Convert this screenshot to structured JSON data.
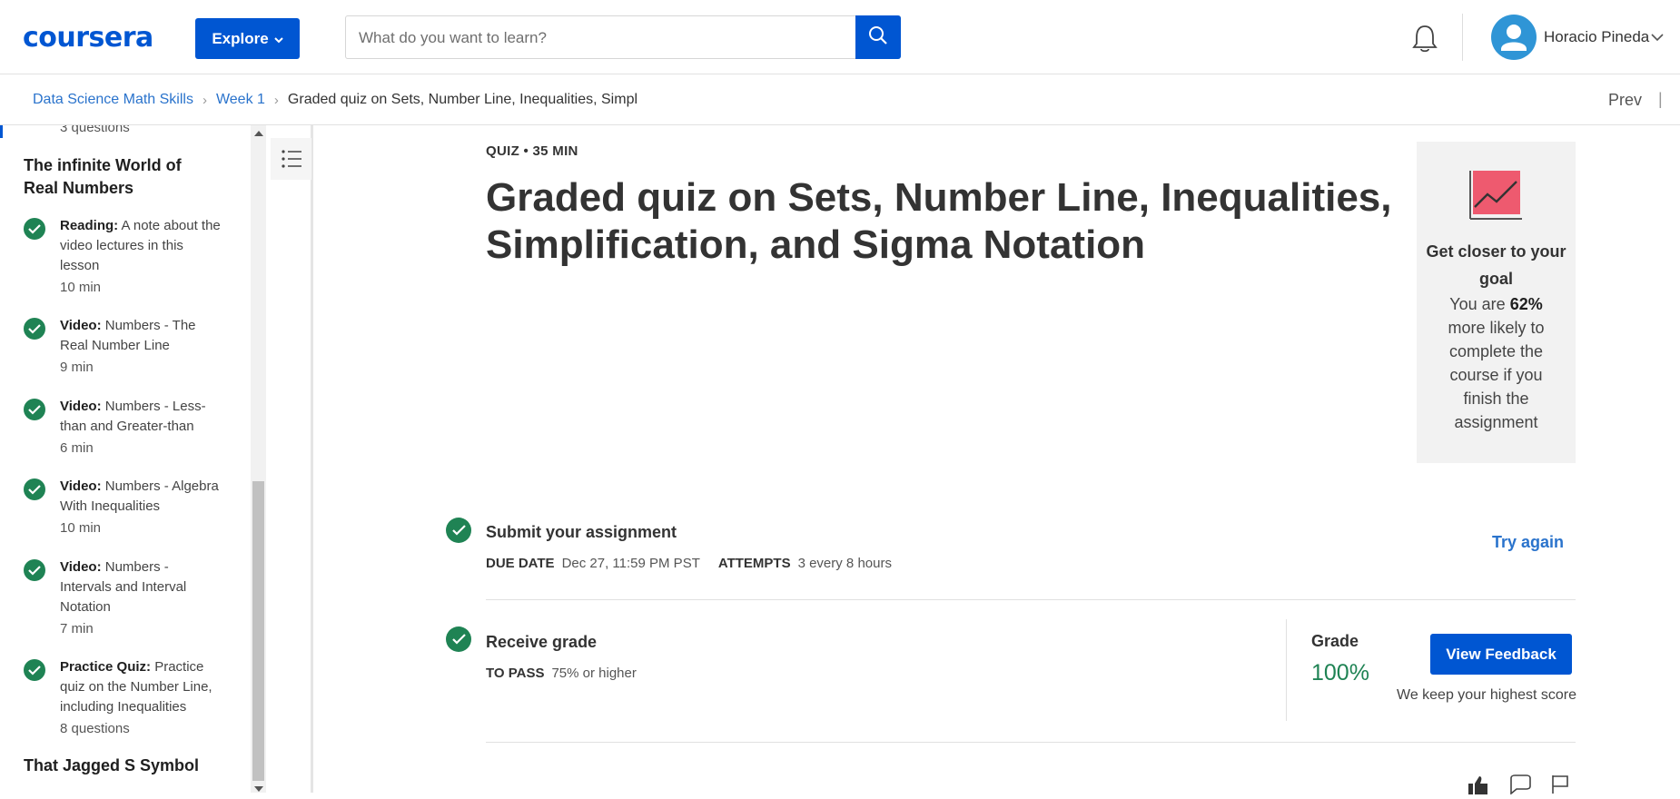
{
  "header": {
    "logo": "coursera",
    "explore_label": "Explore",
    "search_placeholder": "What do you want to learn?",
    "user_name": "Horacio Pineda"
  },
  "breadcrumb": {
    "items": [
      "Data Science Math Skills",
      "Week 1",
      "Graded quiz on Sets, Number Line, Inequalities, Simpl"
    ],
    "prev_label": "Prev",
    "separator": "|"
  },
  "sidebar": {
    "top_meta": "3 questions",
    "section_1": "The infinite World of Real Numbers",
    "items": [
      {
        "type": "Reading:",
        "title": "A note about the video lectures in this lesson",
        "duration": "10 min"
      },
      {
        "type": "Video:",
        "title": "Numbers - The Real Number Line",
        "duration": "9 min"
      },
      {
        "type": "Video:",
        "title": "Numbers - Less-than and Greater-than",
        "duration": "6 min"
      },
      {
        "type": "Video:",
        "title": "Numbers - Algebra With Inequalities",
        "duration": "10 min"
      },
      {
        "type": "Video:",
        "title": "Numbers - Intervals and Interval Notation",
        "duration": "7 min"
      },
      {
        "type": "Practice Quiz:",
        "title": "Practice quiz on the Number Line, including Inequalities",
        "duration": "8 questions"
      }
    ],
    "section_2": "That Jagged S Symbol"
  },
  "main": {
    "quiz_meta": "QUIZ • 35 MIN",
    "title": "Graded quiz on Sets, Number Line, Inequalities, Simplification, and Sigma Notation",
    "submit": {
      "title": "Submit your assignment",
      "due_label": "DUE DATE",
      "due_value": "Dec 27, 11:59 PM PST",
      "attempts_label": "ATTEMPTS",
      "attempts_value": "3 every 8 hours",
      "action": "Try again"
    },
    "receive": {
      "title": "Receive grade",
      "pass_label": "TO PASS",
      "pass_value": "75% or higher",
      "grade_label": "Grade",
      "grade_value": "100%",
      "button": "View Feedback",
      "note": "We keep your highest score"
    }
  },
  "goal_card": {
    "title": "Get closer to your goal",
    "body_prefix": "You are",
    "percent": "62%",
    "body_suffix": "more likely to complete the course if you finish the assignment"
  },
  "colors": {
    "brand": "#0056d2",
    "success": "#1f8354",
    "link": "#2a73cc"
  }
}
